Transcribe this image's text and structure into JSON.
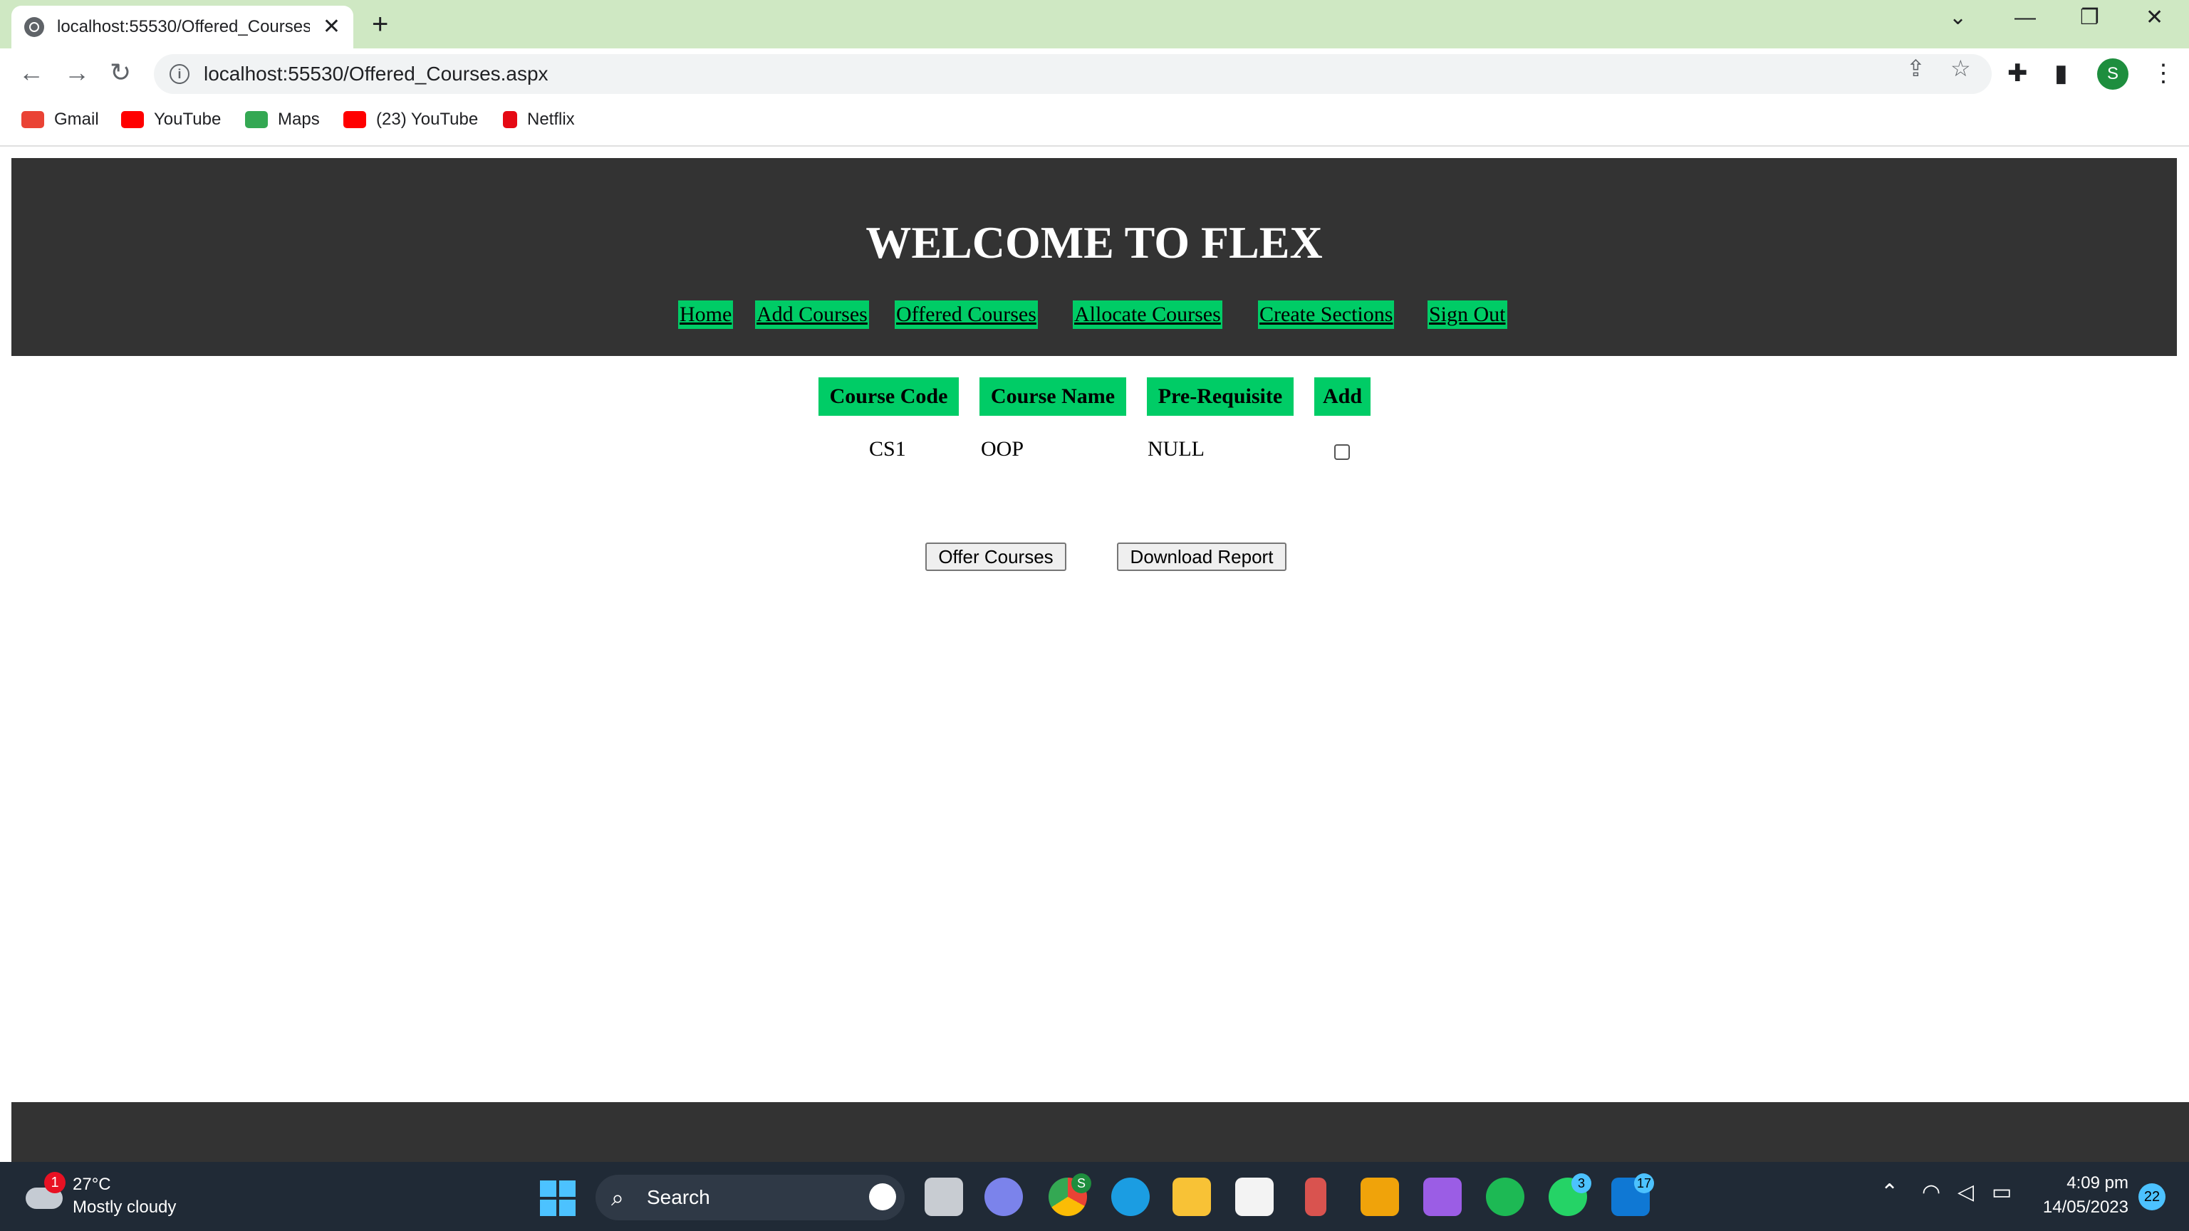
{
  "browser": {
    "tab_title": "localhost:55530/Offered_Courses.aspx",
    "new_tab": "+",
    "url": "localhost:55530/Offered_Courses.aspx",
    "profile_initial": "S",
    "bookmarks": [
      {
        "label": "Gmail",
        "icon": "gmail-icon",
        "color": "#ea4335"
      },
      {
        "label": "YouTube",
        "icon": "youtube-icon",
        "color": "#ff0000"
      },
      {
        "label": "Maps",
        "icon": "maps-icon",
        "color": "#34a853"
      },
      {
        "label": "(23) YouTube",
        "icon": "youtube-icon",
        "color": "#ff0000"
      },
      {
        "label": "Netflix",
        "icon": "netflix-icon",
        "color": "#e50914"
      }
    ]
  },
  "page": {
    "title": "WELCOME TO FLEX",
    "nav": [
      "Home",
      "Add Courses",
      "Offered Courses",
      "Allocate Courses",
      "Create Sections",
      "Sign Out"
    ],
    "table": {
      "headers": [
        "Course Code",
        "Course Name",
        "Pre-Requisite",
        "Add"
      ],
      "rows": [
        {
          "code": "CS1",
          "name": "OOP",
          "prereq": "NULL",
          "checked": false
        }
      ]
    },
    "buttons": {
      "offer": "Offer Courses",
      "download": "Download Report"
    },
    "colors": {
      "header_bg": "#333333",
      "accent": "#00cc66"
    }
  },
  "taskbar": {
    "weather_badge": "1",
    "temperature": "27°C",
    "weather": "Mostly cloudy",
    "search_label": "Search",
    "chrome_badge": "S",
    "whatsapp_badge": "3",
    "mail_badge": "17",
    "time": "4:09 pm",
    "date": "14/05/2023",
    "notifications": "22"
  }
}
